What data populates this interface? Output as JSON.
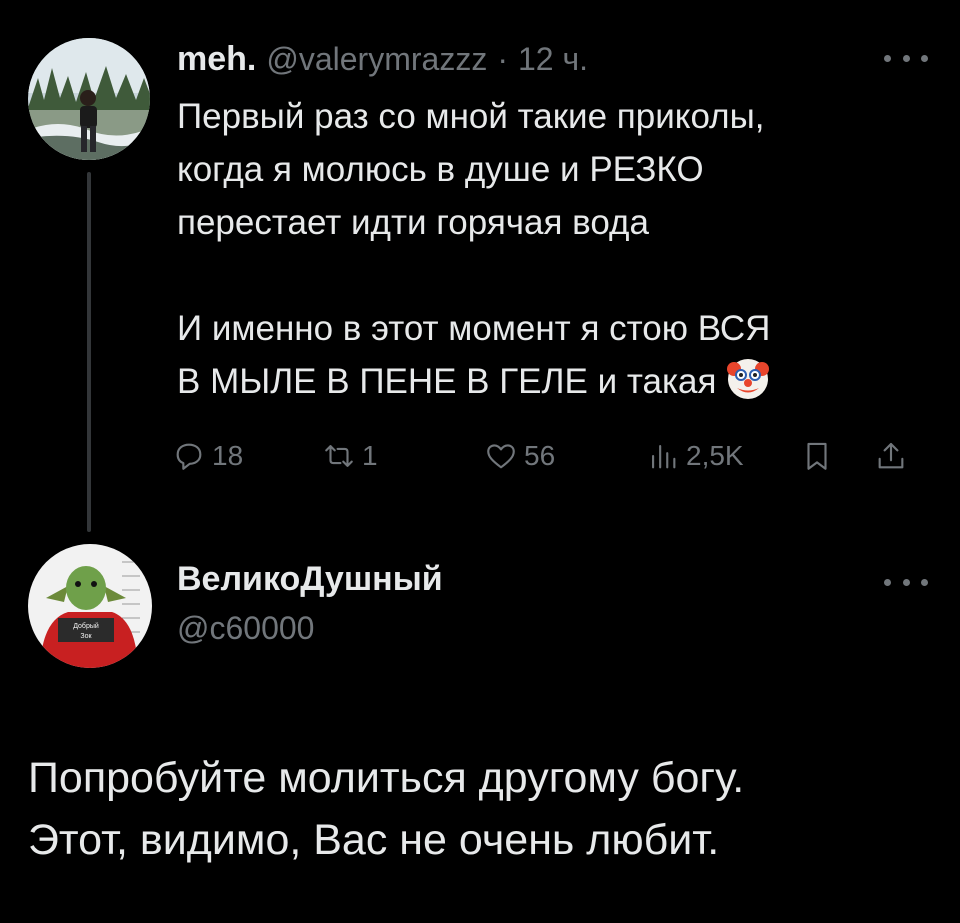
{
  "tweet1": {
    "author_name": "meh.",
    "handle": "@valerymrazzz",
    "separator": "·",
    "time": "12 ч.",
    "text_lines": [
      "Первый раз со мной такие приколы,",
      "когда я молюсь в душе и РЕЗКО",
      "перестает идти горячая вода",
      "И именно в этот момент я стою ВСЯ",
      "В МЫЛЕ В ПЕНЕ В ГЕЛЕ и такая"
    ],
    "emoji": "clown-face",
    "actions": {
      "replies": "18",
      "retweets": "1",
      "likes": "56",
      "views": "2,5K"
    }
  },
  "tweet2": {
    "author_name": "ВеликоДушный",
    "handle": "@c60000",
    "avatar_sign_line1": "Добрый",
    "avatar_sign_line2": "Зок",
    "text_lines": [
      "Попробуйте молиться другому богу.",
      "Этот, видимо, Вас не очень любит."
    ]
  },
  "icons": {
    "more": "more-horizontal-icon",
    "reply": "reply-icon",
    "retweet": "retweet-icon",
    "like": "heart-icon",
    "views": "views-icon",
    "bookmark": "bookmark-icon",
    "share": "share-icon"
  },
  "colors": {
    "background": "#000000",
    "text_primary": "#e7e9ea",
    "text_secondary": "#71767b",
    "thread_line": "#333639"
  }
}
